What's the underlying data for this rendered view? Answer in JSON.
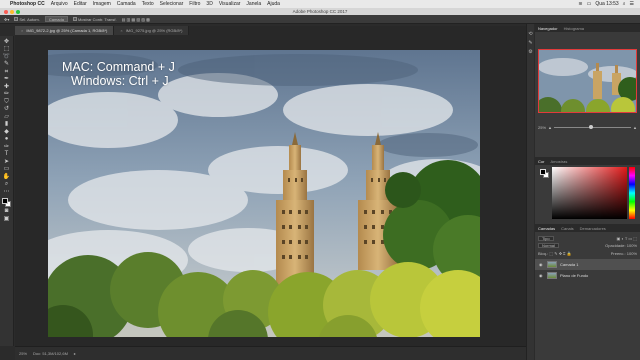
{
  "menubar": {
    "apple_icon": "apple-icon",
    "app": "Photoshop CC",
    "items": [
      "Arquivo",
      "Editar",
      "Imagem",
      "Camada",
      "Texto",
      "Selecionar",
      "Filtro",
      "3D",
      "Visualizar",
      "Janela",
      "Ajuda"
    ],
    "clock": "Qua 13:53"
  },
  "window": {
    "title": "Adobe Photoshop CC 2017"
  },
  "options_bar": {
    "auto_select_label": "Sel. Autom.",
    "layer_dropdown": "Camada",
    "transform_label": "Mostrar Contr. Transf."
  },
  "tabs": [
    {
      "label": "IMG_9872-2.jpg @ 25% (Camada 1, RGB/8*)",
      "active": true
    },
    {
      "label": "IMG_9275.jpg @ 25% (RGB/8*)",
      "active": false
    }
  ],
  "overlay": {
    "line1": "MAC: Command + J",
    "line2": "Windows: Ctrl + J"
  },
  "status": {
    "zoom": "25%",
    "doc": "Doc: 51,3M/102,6M"
  },
  "navigator": {
    "tabs": [
      "Navegador",
      "Histograma"
    ],
    "zoom": "25%"
  },
  "color_panel": {
    "tabs": [
      "Cor",
      "Amostras"
    ]
  },
  "layers_panel": {
    "tabs": [
      "Camadas",
      "Canais",
      "Demarcadores"
    ],
    "kind": "Tipo",
    "blend_mode": "Normal",
    "opacity_label": "Opacidade:",
    "opacity_value": "100%",
    "lock_label": "Bloq.:",
    "fill_label": "Preenc.:",
    "fill_value": "100%",
    "layers": [
      {
        "name": "Camada 1",
        "selected": true
      },
      {
        "name": "Plano de Fundo",
        "selected": false
      }
    ]
  },
  "colors": {
    "accent_red": "#e23b3b",
    "panel_bg": "#3a3a3a",
    "canvas_bg": "#282828"
  }
}
